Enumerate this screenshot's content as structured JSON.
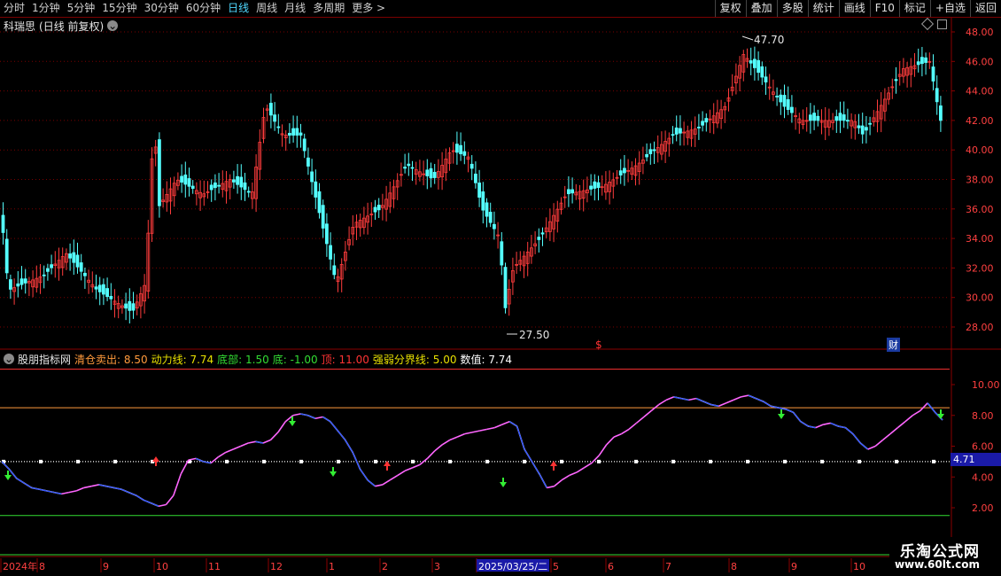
{
  "toolbar": {
    "periods": [
      "分时",
      "1分钟",
      "5分钟",
      "15分钟",
      "30分钟",
      "60分钟",
      "日线",
      "周线",
      "月线",
      "多周期",
      "更多 >"
    ],
    "active_period": "日线",
    "tools": [
      "复权",
      "叠加",
      "多股",
      "统计",
      "画线",
      "F10",
      "标记",
      "+自选",
      "返回"
    ]
  },
  "main_panel": {
    "stock_name": "科瑞思",
    "mode": "(日线 前复权)",
    "y_axis": [
      "48.00",
      "46.00",
      "44.00",
      "42.00",
      "40.00",
      "38.00",
      "36.00",
      "34.00",
      "32.00",
      "30.00",
      "28.00"
    ],
    "high_label": "47.70",
    "low_label": "27.50",
    "marker_dollar": "$",
    "marker_cai": "财"
  },
  "indicator_panel": {
    "name": "股朋指标网",
    "items": [
      {
        "label": "清仓卖出",
        "value": "8.50",
        "color": "#ff9a3c"
      },
      {
        "label": "动力线",
        "value": "7.74",
        "color": "#e8e000"
      },
      {
        "label": "底部",
        "value": "1.50",
        "color": "#33dd33"
      },
      {
        "label": "底",
        "value": "-1.00",
        "color": "#33dd33"
      },
      {
        "label": "顶",
        "value": "11.00",
        "color": "#ff3333"
      },
      {
        "label": "强弱分界线",
        "value": "5.00",
        "color": "#e8e000"
      },
      {
        "label": "数值",
        "value": "7.74",
        "color": "#ffffff"
      }
    ],
    "y_axis": [
      "10.00",
      "8.00",
      "6.00",
      "4.00",
      "2.00"
    ],
    "current_value_tag": "4.71",
    "chart_data": {
      "type": "line",
      "series": [
        {
          "name": "数值",
          "values": [
            5.0,
            4.5,
            3.9,
            3.6,
            3.3,
            3.2,
            3.1,
            3.0,
            2.9,
            3.0,
            3.1,
            3.3,
            3.4,
            3.5,
            3.4,
            3.3,
            3.2,
            3.0,
            2.8,
            2.5,
            2.3,
            2.1,
            2.2,
            2.8,
            4.2,
            5.1,
            5.2,
            5.0,
            4.9,
            5.3,
            5.6,
            5.8,
            6.0,
            6.2,
            6.3,
            6.2,
            6.4,
            6.9,
            7.6,
            8.0,
            8.1,
            8.0,
            7.8,
            7.9,
            7.6,
            7.0,
            6.4,
            5.6,
            4.5,
            3.8,
            3.4,
            3.5,
            3.8,
            4.1,
            4.4,
            4.6,
            4.8,
            5.2,
            5.7,
            6.1,
            6.4,
            6.6,
            6.8,
            6.9,
            7.0,
            7.1,
            7.2,
            7.4,
            7.6,
            7.3,
            5.8,
            5.0,
            4.2,
            3.3,
            3.4,
            3.8,
            4.1,
            4.3,
            4.6,
            4.9,
            5.4,
            6.1,
            6.6,
            6.8,
            7.1,
            7.5,
            7.9,
            8.3,
            8.7,
            9.0,
            9.2,
            9.1,
            9.0,
            9.1,
            8.9,
            8.7,
            8.6,
            8.8,
            9.0,
            9.2,
            9.3,
            9.1,
            8.9,
            8.6,
            8.5,
            8.4,
            8.2,
            7.6,
            7.3,
            7.2,
            7.4,
            7.5,
            7.3,
            7.2,
            6.8,
            6.2,
            5.8,
            6.0,
            6.4,
            6.8,
            7.2,
            7.6,
            8.0,
            8.3,
            8.8,
            8.2,
            7.7
          ]
        }
      ],
      "ylim": [
        0,
        12
      ],
      "horizontal_lines": [
        {
          "name": "顶",
          "value": 11.0,
          "color": "#ff3333"
        },
        {
          "name": "清仓卖出",
          "value": 8.5,
          "color": "#ff9a3c"
        },
        {
          "name": "强弱分界线",
          "value": 5.0,
          "color": "#ffffff"
        },
        {
          "name": "底部",
          "value": 1.5,
          "color": "#33dd33"
        },
        {
          "name": "底",
          "value": -1.0,
          "color": "#33dd33"
        }
      ]
    }
  },
  "date_axis": {
    "labels": [
      "2024年",
      "8",
      "9",
      "10",
      "11",
      "12",
      "1",
      "2",
      "3",
      "2025/03/25/二",
      "5",
      "6",
      "7",
      "8",
      "9",
      "10"
    ]
  },
  "watermark": {
    "line1": "乐淘公式网",
    "line2": "www.60lt.com"
  }
}
